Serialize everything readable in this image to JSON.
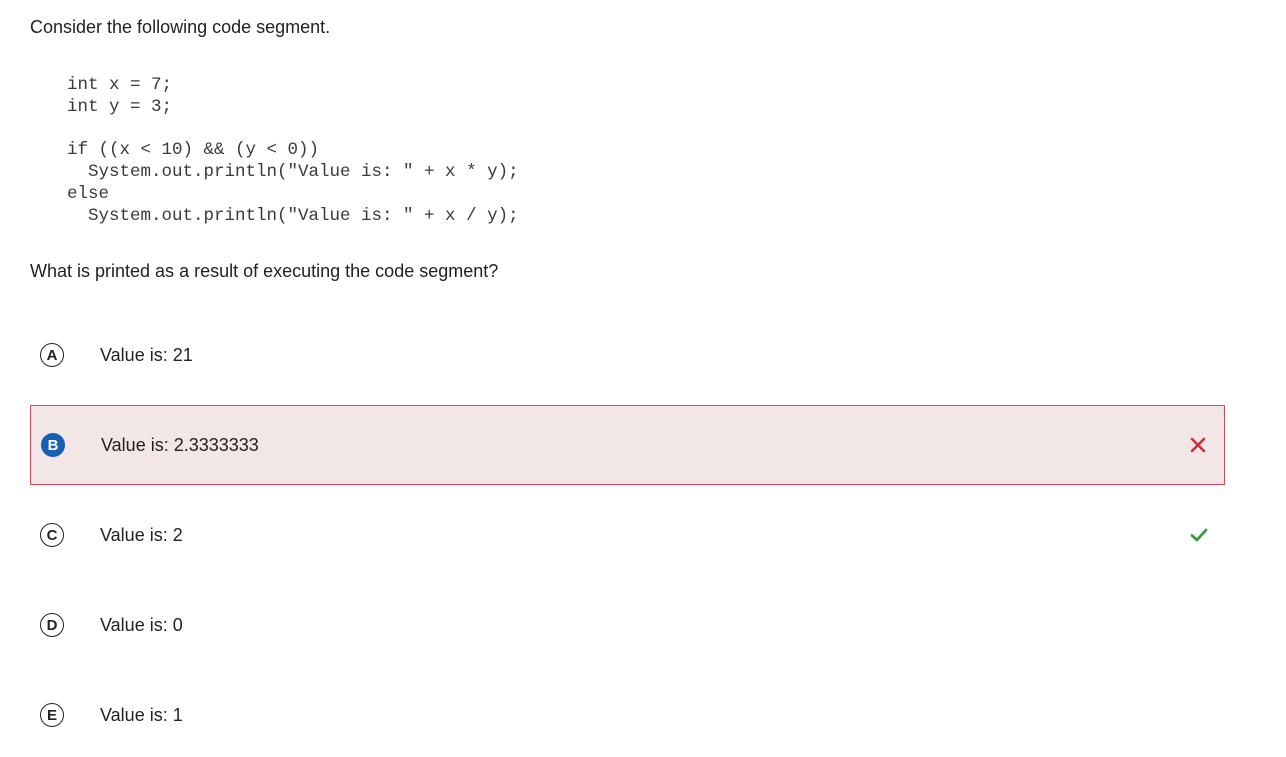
{
  "question": {
    "prompt": "Consider the following code segment.",
    "code_lines": [
      "int x = 7;",
      "int y = 3;",
      "",
      "if ((x < 10) && (y < 0))",
      "  System.out.println(\"Value is: \" + x * y);",
      "else",
      "  System.out.println(\"Value is: \" + x / y);"
    ],
    "stem": "What is printed as a result of executing the code segment?"
  },
  "choices": [
    {
      "letter": "A",
      "text": "Value is: 21",
      "state": "unselected"
    },
    {
      "letter": "B",
      "text": "Value is: 2.3333333",
      "state": "selected-incorrect",
      "mark_icon": "x-icon",
      "mark_color": "#c62f3c"
    },
    {
      "letter": "C",
      "text": "Value is: 2",
      "state": "correct",
      "mark_icon": "check-icon",
      "mark_color": "#3a9b3e"
    },
    {
      "letter": "D",
      "text": "Value is: 0",
      "state": "unselected"
    },
    {
      "letter": "E",
      "text": "Value is: 1",
      "state": "unselected"
    }
  ],
  "colors": {
    "selected_fill": "#1a5fb4",
    "incorrect_bg": "#f3e6e7",
    "incorrect_border": "#d9475a"
  }
}
